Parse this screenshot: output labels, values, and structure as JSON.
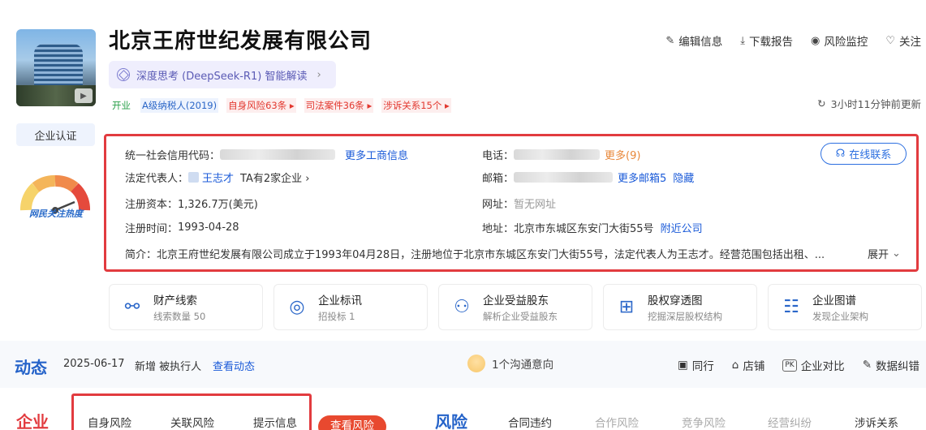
{
  "company": {
    "name": "北京王府世纪发展有限公司",
    "ai_label": "深度思考 (DeepSeek-R1) 智能解读",
    "tags": [
      {
        "text": "开业",
        "style": "green"
      },
      {
        "text": "A级纳税人(2019)",
        "style": "blue"
      },
      {
        "text": "自身风险63条 ▸",
        "style": "red"
      },
      {
        "text": "司法案件36条 ▸",
        "style": "red"
      },
      {
        "text": "涉诉关系15个 ▸",
        "style": "red"
      }
    ]
  },
  "actions": {
    "edit": "编辑信息",
    "download": "下载报告",
    "monitor": "风险监控",
    "follow": "关注"
  },
  "refresh_text": "3小时11分钟前更新",
  "left": {
    "cert_label": "企业认证",
    "heat_label": "网民关注热度"
  },
  "info": {
    "credit_code_label": "统一社会信用代码：",
    "more_business": "更多工商信息",
    "legal_rep_label": "法定代表人：",
    "legal_rep_name": "王志才",
    "legal_rep_extra": "TA有2家企业 ›",
    "capital_label": "注册资本：",
    "capital_value": "1,326.7万(美元)",
    "reg_time_label": "注册时间：",
    "reg_time_value": "1993-04-28",
    "phone_label": "电话：",
    "phone_more": "更多(9)",
    "email_label": "邮箱：",
    "email_more": "更多邮箱5",
    "email_hide": "隐藏",
    "website_label": "网址：",
    "website_value": "暂无网址",
    "address_label": "地址：",
    "address_value": "北京市东城区东安门大街55号",
    "nearby": "附近公司",
    "intro_label": "简介：",
    "intro_value": "北京王府世纪发展有限公司成立于1993年04月28日，注册地位于北京市东城区东安门大街55号，法定代表人为王志才。经营范围包括出租、...",
    "expand": "展开",
    "online_contact": "在线联系"
  },
  "cards": [
    {
      "title": "财产线索",
      "sub": "线索数量 50",
      "icon": "link-icon"
    },
    {
      "title": "企业标讯",
      "sub": "招投标 1",
      "icon": "target-icon"
    },
    {
      "title": "企业受益股东",
      "sub": "解析企业受益股东",
      "icon": "user-yen-icon"
    },
    {
      "title": "股权穿透图",
      "sub": "挖掘深层股权结构",
      "icon": "hierarchy-icon"
    },
    {
      "title": "企业图谱",
      "sub": "发现企业架构",
      "icon": "graph-icon"
    }
  ],
  "dynamic": {
    "title": "动态",
    "date": "2025-06-17",
    "new_item": "新增 被执行人",
    "view_link": "查看动态",
    "intent": "1个沟通意向",
    "tools": [
      "同行",
      "店铺",
      "企业对比",
      "数据纠错"
    ]
  },
  "bottom": {
    "enterprise": "企业",
    "risk_tabs": [
      "自身风险",
      "关联风险",
      "提示信息"
    ],
    "view_risk": "查看风险",
    "risk_title": "风险",
    "biz_tabs": [
      "合同违约",
      "合作风险",
      "竞争风险",
      "经营纠纷",
      "涉诉关系"
    ]
  },
  "colors": {
    "brand_blue": "#2563c9",
    "alert_red": "#e23b3f",
    "link_blue": "#1a5ad8"
  }
}
